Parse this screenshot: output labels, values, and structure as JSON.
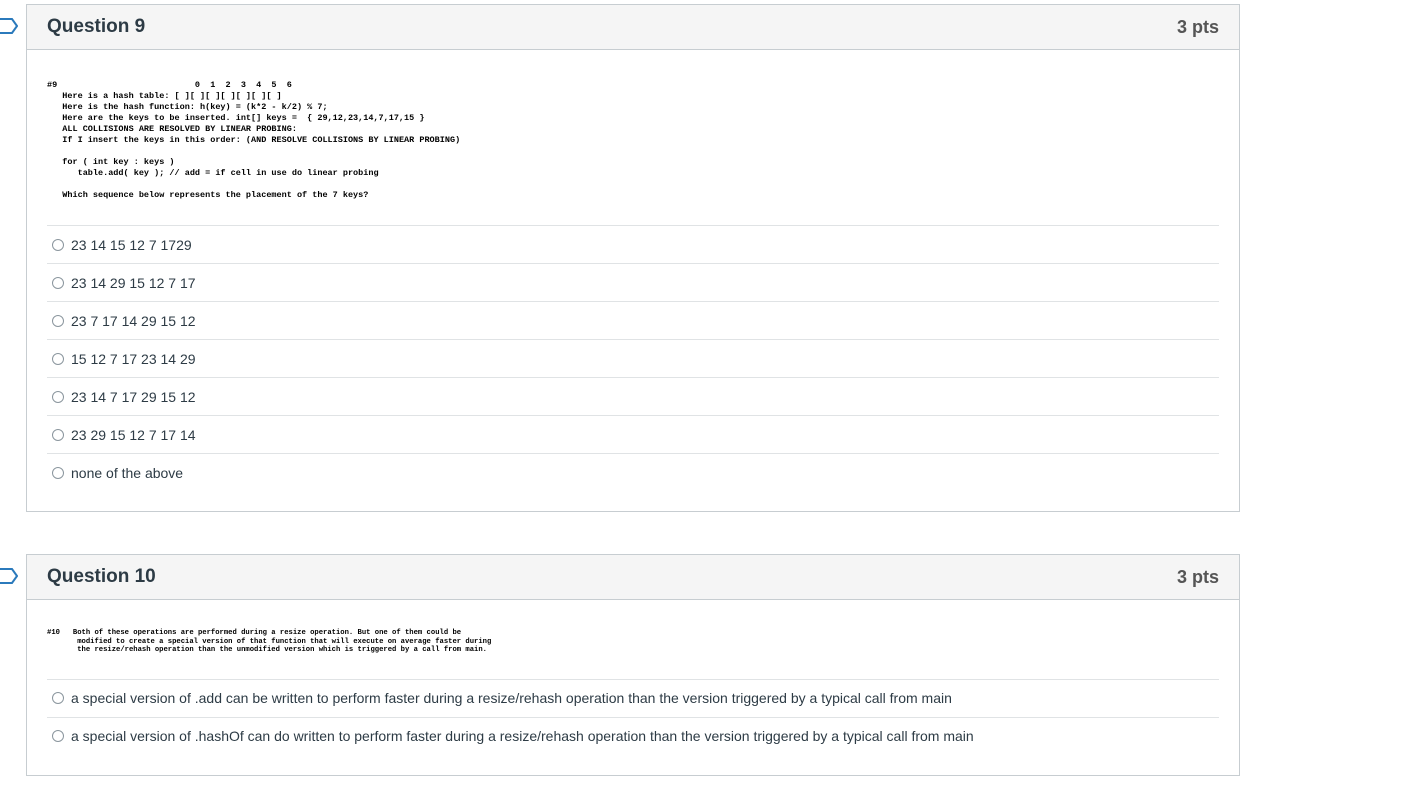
{
  "questions": [
    {
      "title": "Question 9",
      "points": "3 pts",
      "code": "#9                           0  1  2  3  4  5  6\n   Here is a hash table: [ ][ ][ ][ ][ ][ ][ ]\n   Here is the hash function: h(key) = (k*2 - k/2) % 7;\n   Here are the keys to be inserted. int[] keys =  { 29,12,23,14,7,17,15 }\n   ALL COLLISIONS ARE RESOLVED BY LINEAR PROBING:\n   If I insert the keys in this order: (AND RESOLVE COLLISIONS BY LINEAR PROBING)\n\n   for ( int key : keys )\n      table.add( key ); // add = if cell in use do linear probing\n\n   Which sequence below represents the placement of the 7 keys?",
      "answers": [
        "23 14 15 12 7 1729",
        "23 14 29 15 12 7 17",
        "23 7 17 14 29 15 12",
        "15 12 7 17 23 14 29",
        "23 14 7 17 29 15 12",
        "23 29 15 12 7 17 14",
        "none of the above"
      ]
    },
    {
      "title": "Question 10",
      "points": "3 pts",
      "code": "#10   Both of these operations are performed during a resize operation. But one of them could be\n       modified to create a special version of that function that will execute on average faster during\n       the resize/rehash operation than the unmodified version which is triggered by a call from main.",
      "answers": [
        "a special version of .add can be written to perform faster during a resize/rehash operation than the version triggered by a typical call from main",
        "a special version of .hashOf can do written to perform faster during a resize/rehash operation than the version triggered by a typical call from main"
      ]
    }
  ]
}
